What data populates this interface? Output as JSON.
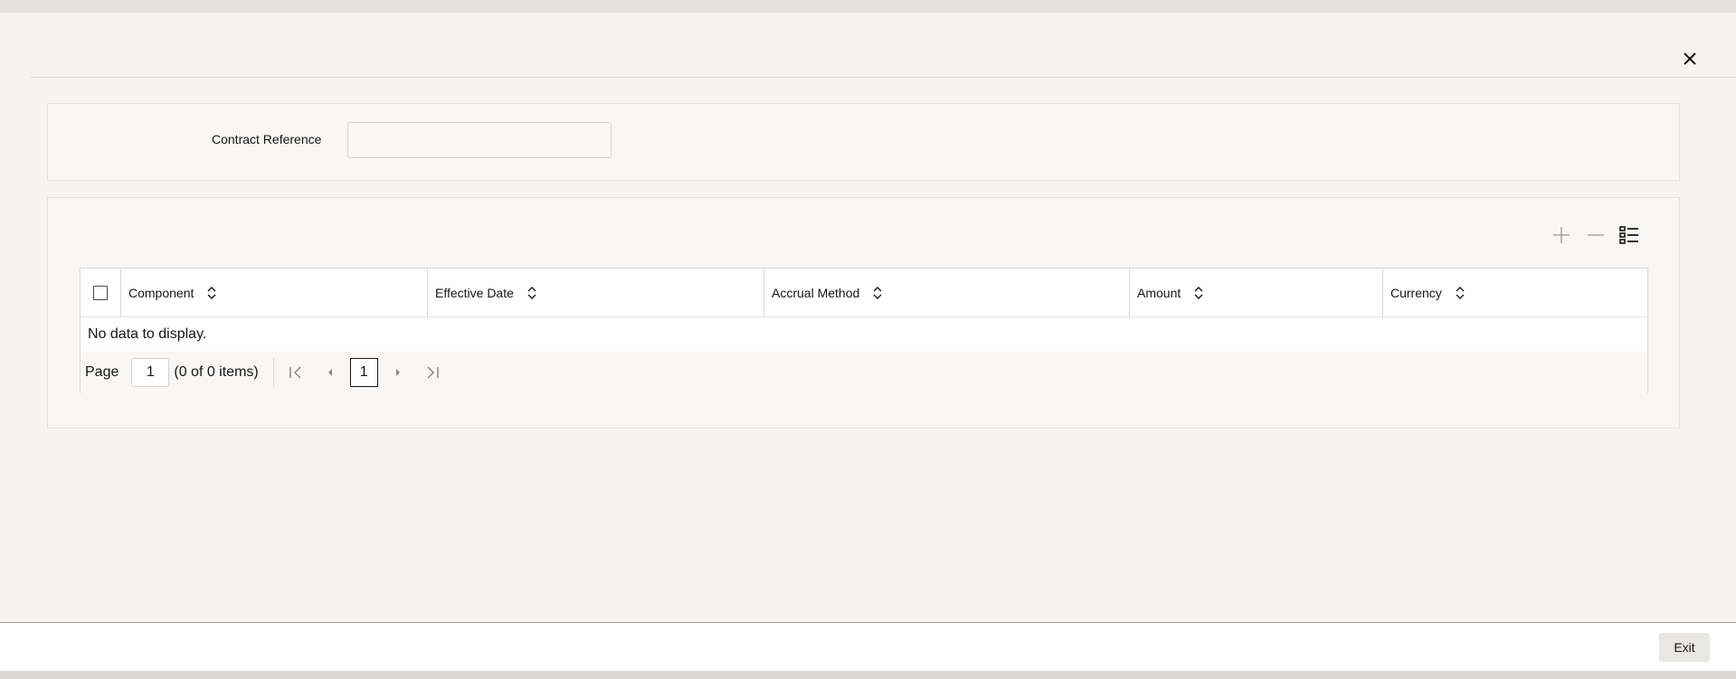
{
  "form": {
    "contract_reference_label": "Contract Reference",
    "contract_reference_value": ""
  },
  "toolbar": {
    "add_icon": "plus-icon",
    "delete_icon": "minus-icon",
    "columns_icon": "list-view-icon"
  },
  "table": {
    "columns": [
      "Component",
      "Effective Date",
      "Accrual Method",
      "Amount",
      "Currency"
    ],
    "empty_message": "No data to display."
  },
  "pager": {
    "page_label": "Page",
    "page_value": "1",
    "count_text": "(0 of 0 items)",
    "current_page": "1"
  },
  "footer": {
    "exit_label": "Exit"
  },
  "colors": {
    "background": "#f1efed",
    "panel": "#f8f7f6",
    "border": "#dcd9d5",
    "text": "#161513"
  }
}
